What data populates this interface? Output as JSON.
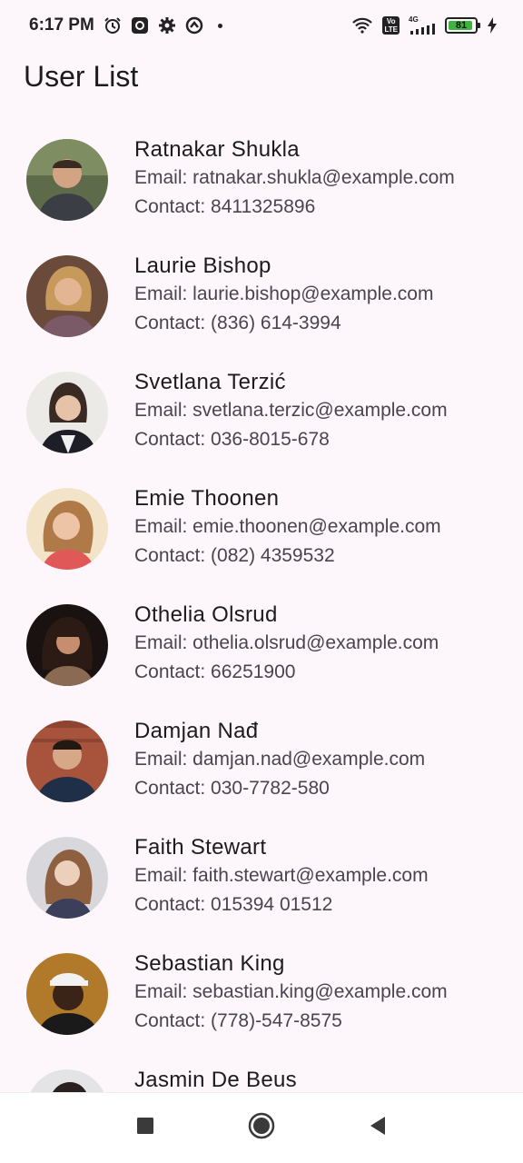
{
  "status_bar": {
    "time": "6:17 PM",
    "battery_level": "81",
    "icons": [
      "alarm-icon",
      "record-icon",
      "gear-icon",
      "vpn-icon",
      "wifi-icon",
      "volte-icon",
      "signal-icon",
      "battery-icon",
      "charging-icon"
    ],
    "volte_label": "Vo\nLTE",
    "network_label": "4G"
  },
  "app_bar": {
    "title": "User List"
  },
  "users": [
    {
      "name": "Ratnakar Shukla",
      "email": "Email: ratnakar.shukla@example.com",
      "contact": "Contact: 8411325896"
    },
    {
      "name": "Laurie Bishop",
      "email": "Email: laurie.bishop@example.com",
      "contact": "Contact: (836) 614-3994"
    },
    {
      "name": "Svetlana Terzić",
      "email": "Email: svetlana.terzic@example.com",
      "contact": "Contact: 036-8015-678"
    },
    {
      "name": "Emie Thoonen",
      "email": "Email: emie.thoonen@example.com",
      "contact": "Contact: (082) 4359532"
    },
    {
      "name": "Othelia Olsrud",
      "email": "Email: othelia.olsrud@example.com",
      "contact": "Contact: 66251900"
    },
    {
      "name": "Damjan Nađ",
      "email": "Email: damjan.nad@example.com",
      "contact": "Contact: 030-7782-580"
    },
    {
      "name": "Faith Stewart",
      "email": "Email: faith.stewart@example.com",
      "contact": "Contact: 015394 01512"
    },
    {
      "name": "Sebastian King",
      "email": "Email: sebastian.king@example.com",
      "contact": "Contact: (778)-547-8575"
    },
    {
      "name": "Jasmin De Beus",
      "email": "",
      "contact": ""
    }
  ],
  "nav_bar": {
    "icons": [
      "recents-icon",
      "home-icon",
      "back-icon"
    ]
  }
}
